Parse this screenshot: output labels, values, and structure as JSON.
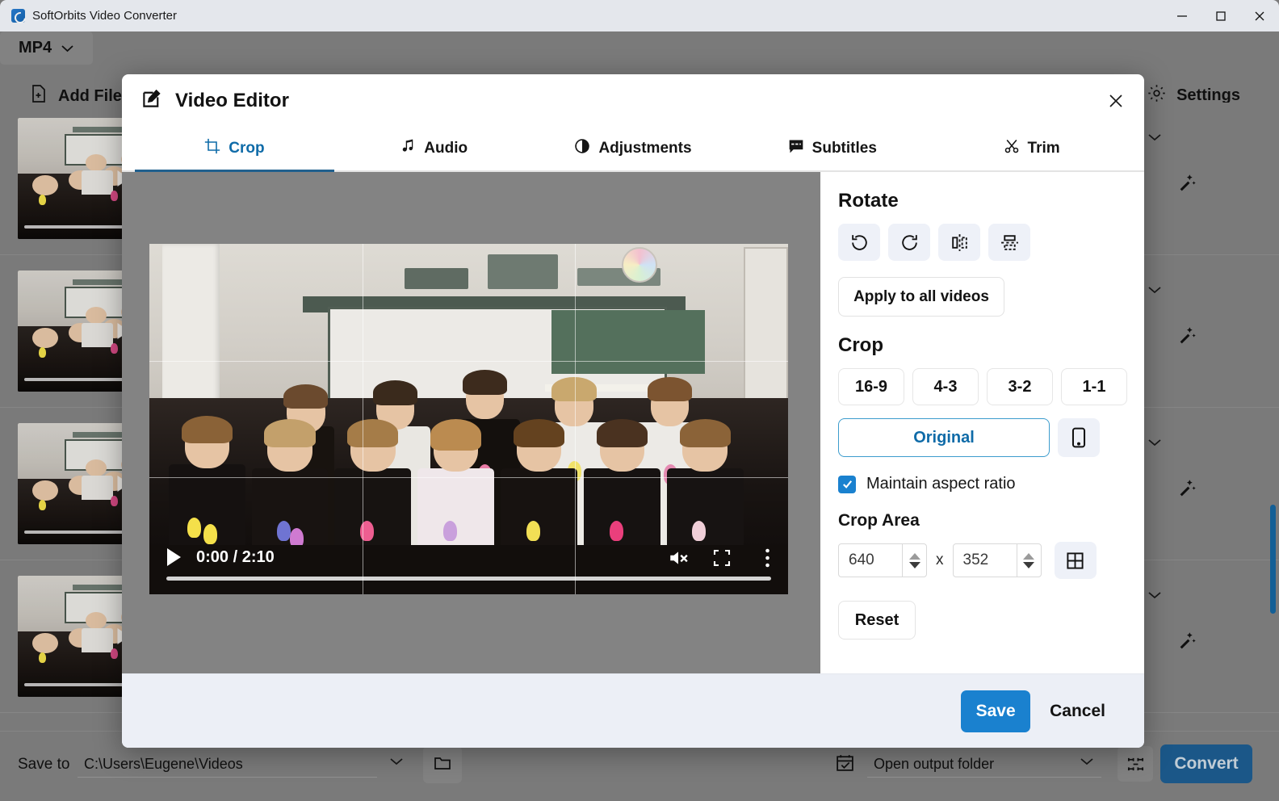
{
  "window": {
    "title": "SoftOrbits Video Converter",
    "controls": {
      "minimize": "minimize-icon",
      "maximize": "maximize-icon",
      "close": "close-icon"
    }
  },
  "toolbar": {
    "add_files": "Add Files",
    "format": "MP4",
    "refresh_icon": "refresh-icon",
    "select_all_icon": "checkbox-checked-icon",
    "settings": "Settings"
  },
  "file_list": {
    "rows": [
      {
        "name": "video-thumbnail-1"
      },
      {
        "name": "video-thumbnail-2"
      },
      {
        "name": "video-thumbnail-3"
      },
      {
        "name": "video-thumbnail-4"
      }
    ]
  },
  "bottom_bar": {
    "save_to_label": "Save to",
    "save_to_path": "C:\\Users\\Eugene\\Videos",
    "open_output": "Open output folder",
    "convert": "Convert"
  },
  "dialog": {
    "title": "Video Editor",
    "close_icon": "close-icon",
    "tabs": [
      {
        "label": "Crop",
        "icon": "crop-icon",
        "active": true
      },
      {
        "label": "Audio",
        "icon": "music-note-icon",
        "active": false
      },
      {
        "label": "Adjustments",
        "icon": "contrast-circle-icon",
        "active": false
      },
      {
        "label": "Subtitles",
        "icon": "subtitles-icon",
        "active": false
      },
      {
        "label": "Trim",
        "icon": "scissors-icon",
        "active": false
      }
    ],
    "player": {
      "current_time": "0:00",
      "total_time": "2:10",
      "time_display": "0:00 / 2:10",
      "play_icon": "play-icon",
      "mute_icon": "volume-muted-icon",
      "fullscreen_icon": "fullscreen-icon",
      "more_icon": "more-vertical-icon"
    },
    "panel": {
      "rotate_title": "Rotate",
      "rotate_buttons": [
        {
          "name": "rotate-left-icon"
        },
        {
          "name": "rotate-right-icon"
        },
        {
          "name": "flip-horizontal-icon"
        },
        {
          "name": "flip-vertical-icon"
        }
      ],
      "apply_all": "Apply to all videos",
      "crop_title": "Crop",
      "ratios": [
        "16-9",
        "4-3",
        "3-2",
        "1-1"
      ],
      "original": "Original",
      "portrait_icon": "phone-portrait-icon",
      "maintain_aspect_label": "Maintain aspect ratio",
      "maintain_aspect_checked": true,
      "crop_area_title": "Crop Area",
      "crop_width": "640",
      "crop_height": "352",
      "crop_separator": "x",
      "grid_icon": "grid-icon",
      "reset": "Reset"
    },
    "footer": {
      "save": "Save",
      "cancel": "Cancel"
    }
  },
  "colors": {
    "accent_blue": "#1a81cf",
    "tab_active": "#0f6ba8",
    "convert_blue": "#1d5d91",
    "panel_bg": "#eceff6",
    "app_gray": "#828282"
  }
}
